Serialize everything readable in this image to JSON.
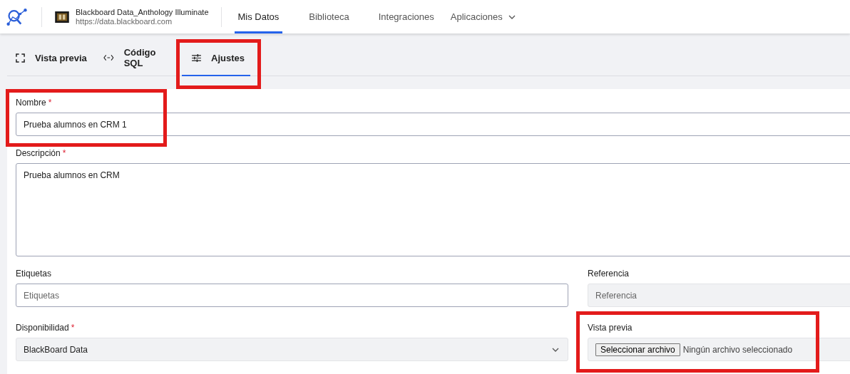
{
  "header": {
    "brand": {
      "title": "Blackboard Data_Anthology Illuminate",
      "url": "https://data.blackboard.com"
    },
    "nav": [
      {
        "label": "Mis Datos",
        "selected": true,
        "kind": "link"
      },
      {
        "label": "Biblioteca",
        "selected": false,
        "kind": "link"
      },
      {
        "label": "Integraciones",
        "selected": false,
        "kind": "link"
      },
      {
        "label": "Aplicaciones",
        "selected": false,
        "kind": "dropdown"
      }
    ]
  },
  "subtabs": [
    {
      "label": "Vista previa",
      "selected": false,
      "kind": "preview"
    },
    {
      "label": "Código SQL",
      "selected": false,
      "kind": "sql"
    },
    {
      "label": "Ajustes",
      "selected": true,
      "kind": "settings"
    }
  ],
  "form": {
    "full": [
      {
        "label": "Nombre",
        "required_mark": "*",
        "kind": "text",
        "value": "Prueba alumnos en CRM 1",
        "disabled": false
      },
      {
        "label": "Descripción",
        "required_mark": "*",
        "kind": "textarea",
        "value": "Prueba alumnos en CRM",
        "disabled": false
      }
    ],
    "grid": [
      {
        "label": "Etiquetas",
        "kind": "text",
        "placeholder": "Etiquetas",
        "disabled": false
      },
      {
        "label": "Referencia",
        "kind": "text",
        "placeholder": "Referencia",
        "disabled": true
      },
      {
        "label": "Disponibilidad",
        "required_mark": "*",
        "kind": "select",
        "value": "BlackBoard Data",
        "disabled": true
      },
      {
        "label": "Vista previa",
        "kind": "file",
        "button": "Seleccionar archivo",
        "status": "Ningún archivo seleccionado",
        "disabled": true
      }
    ]
  }
}
